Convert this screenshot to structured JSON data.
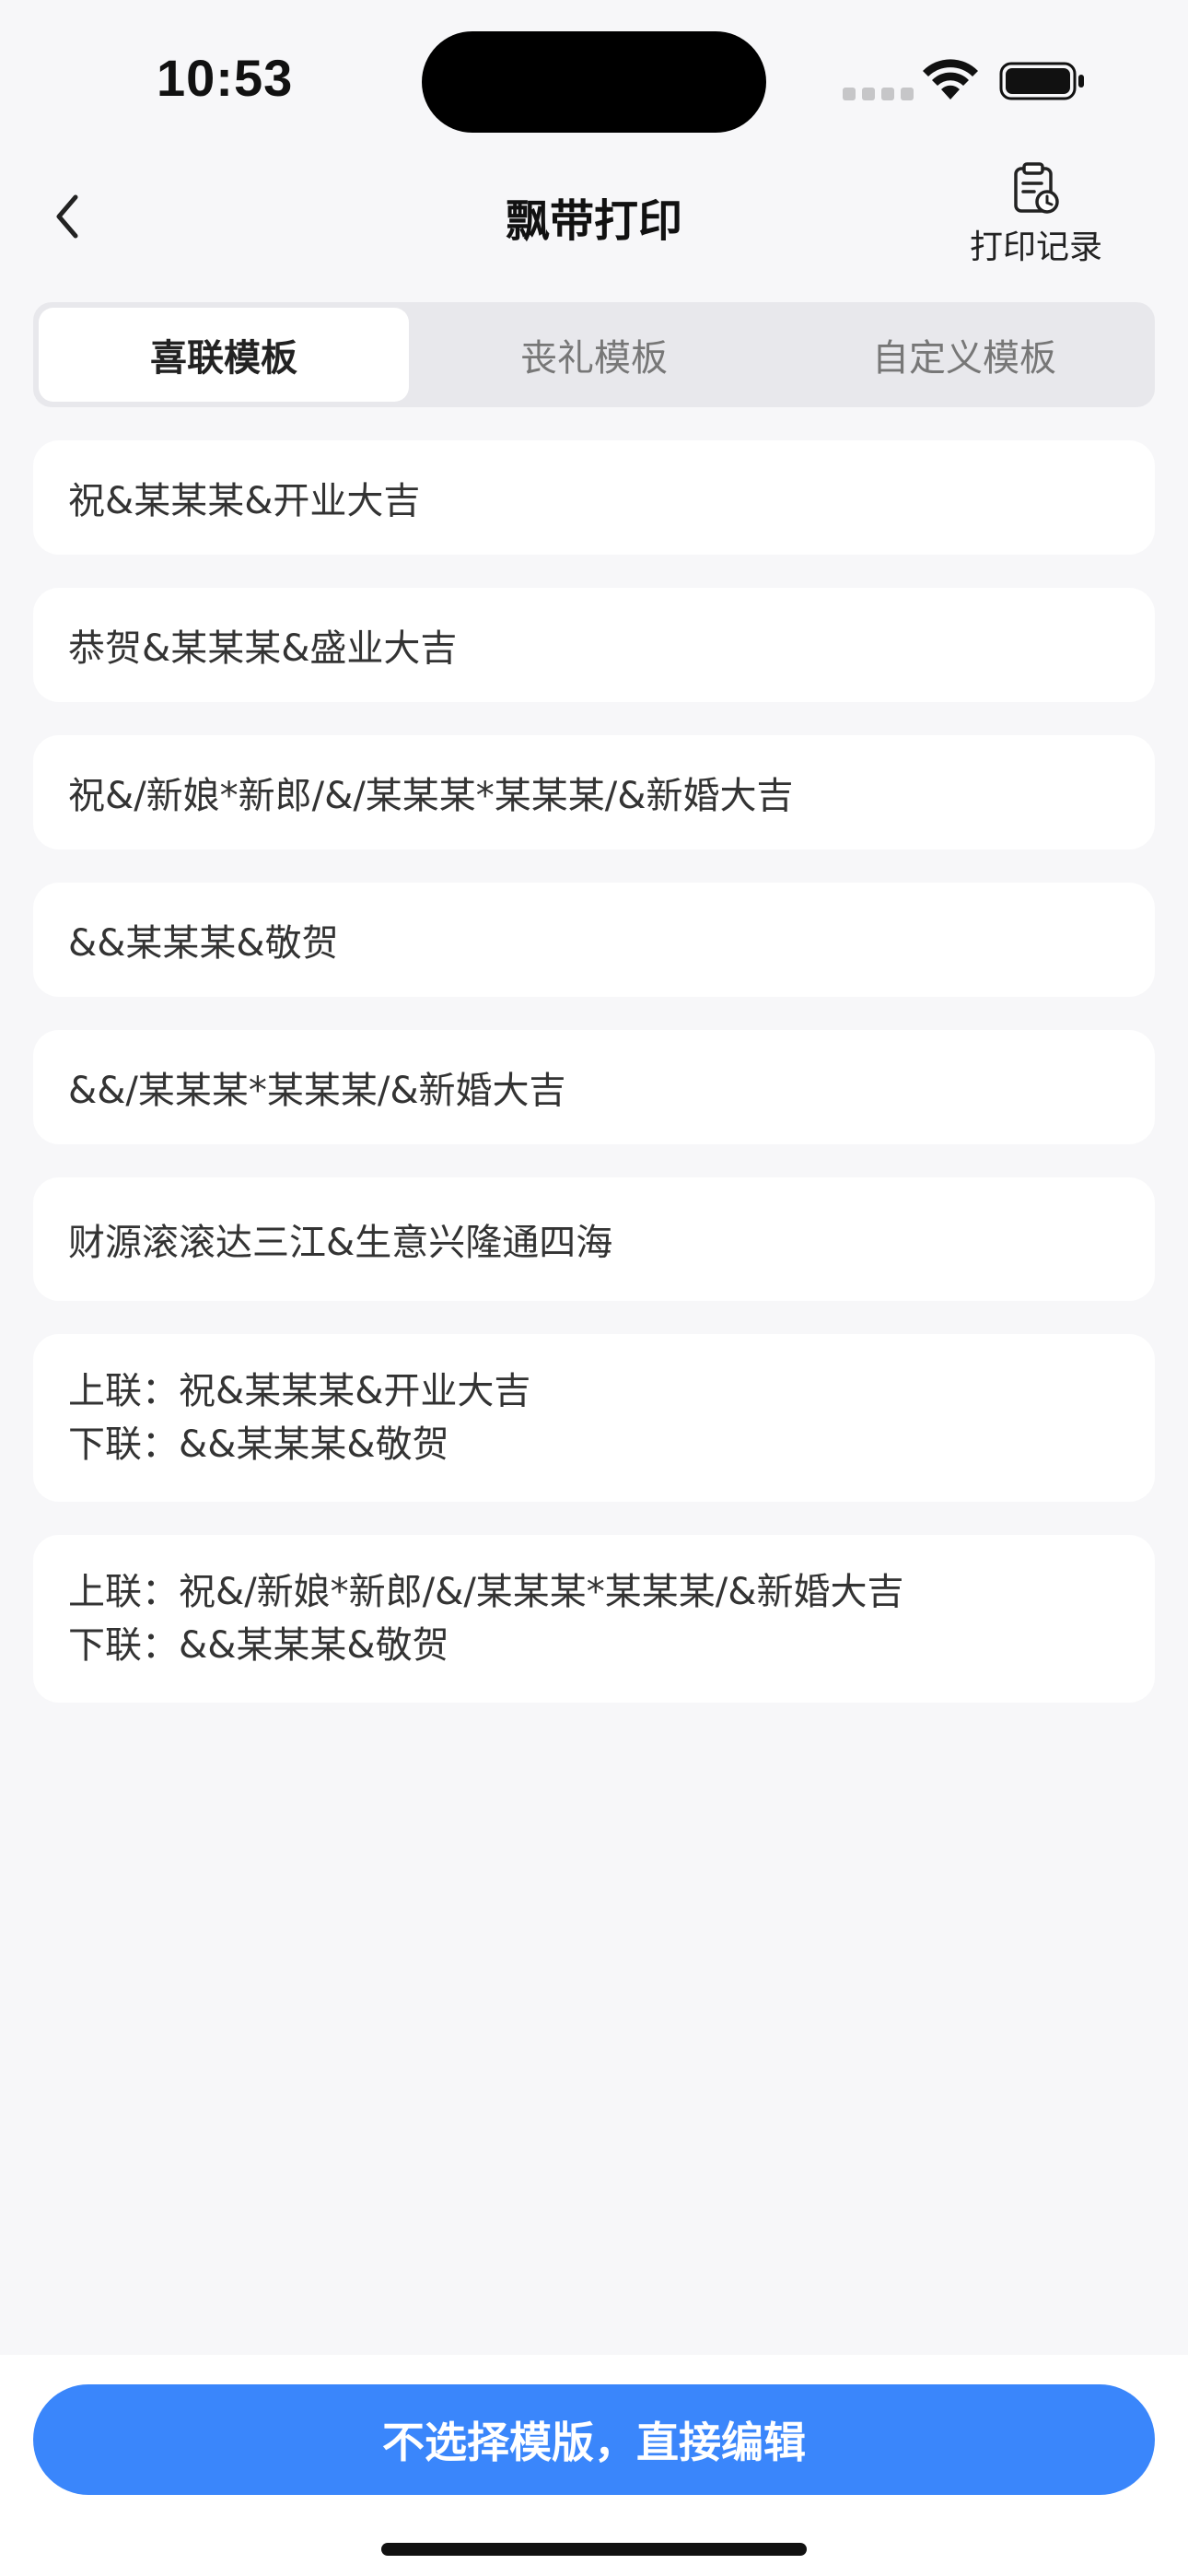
{
  "status_bar": {
    "time": "10:53"
  },
  "nav": {
    "title": "飘带打印",
    "history_label": "打印记录"
  },
  "tabs": [
    {
      "label": "喜联模板",
      "active": true
    },
    {
      "label": "丧礼模板",
      "active": false
    },
    {
      "label": "自定义模板",
      "active": false
    }
  ],
  "templates": [
    {
      "lines": [
        "祝&某某某&开业大吉"
      ]
    },
    {
      "lines": [
        "恭贺&某某某&盛业大吉"
      ]
    },
    {
      "lines": [
        "祝&/新娘*新郎/&/某某某*某某某/&新婚大吉"
      ]
    },
    {
      "lines": [
        "&&某某某&敬贺"
      ]
    },
    {
      "lines": [
        "&&/某某某*某某某/&新婚大吉"
      ]
    },
    {
      "lines": [
        "财源滚滚达三江&生意兴隆通四海"
      ]
    },
    {
      "lines": [
        "上联：祝&某某某&开业大吉",
        "下联：&&某某某&敬贺"
      ]
    },
    {
      "lines": [
        "上联：祝&/新娘*新郎/&/某某某*某某某/&新婚大吉",
        "下联：&&某某某&敬贺"
      ]
    }
  ],
  "bottom": {
    "button_label": "不选择模版，直接编辑"
  },
  "colors": {
    "accent": "#3a86fb",
    "background": "#f7f7f9"
  }
}
